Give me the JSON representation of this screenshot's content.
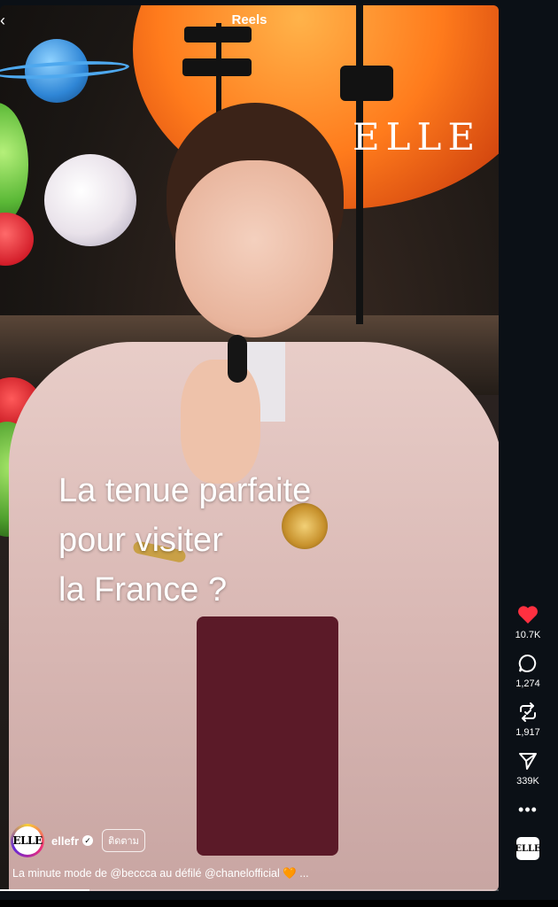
{
  "header": {
    "title": "Reels",
    "back_glyph": "‹"
  },
  "video": {
    "brand_watermark": "ELLE",
    "overlay_text_line1": "La tenue parfaite",
    "overlay_text_line2": "pour visiter",
    "overlay_text_line3": "la France ?",
    "progress": 0.18
  },
  "post": {
    "avatar_text": "ELLE",
    "account": "ellefr",
    "verified_glyph": "✓",
    "follow_label": "ติดตาม",
    "caption": "La minute mode de @beccca au défilé @chanelofficial 🧡 ..."
  },
  "actions": {
    "likes": "10.7K",
    "comments": "1,274",
    "reposts": "1,917",
    "shares": "339K",
    "more_glyph": "•••",
    "audio_avatar_text": "ELLE"
  },
  "colors": {
    "like_red": "#ff3040",
    "background": "#0b1016"
  },
  "icons": {
    "back": "back-arrow-icon",
    "like": "heart-icon",
    "comment": "comment-bubble-icon",
    "repost": "repost-icon",
    "share": "send-icon",
    "more": "more-dots-icon"
  }
}
